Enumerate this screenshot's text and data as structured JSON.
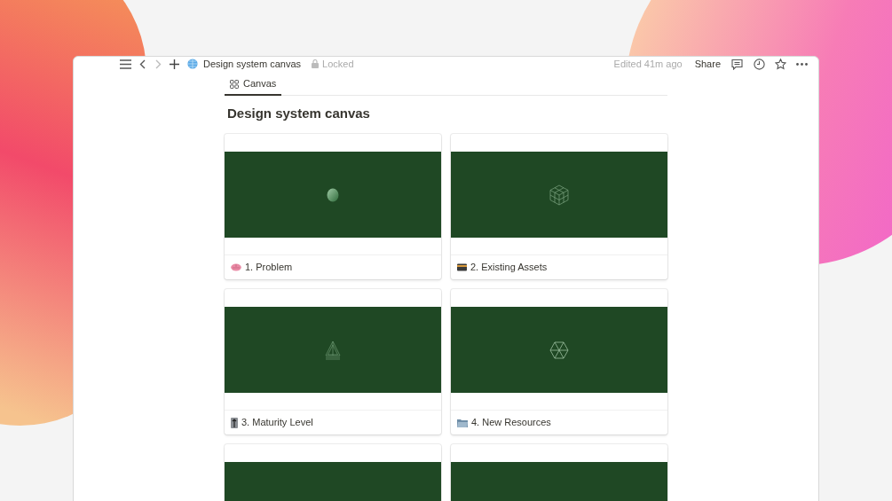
{
  "topbar": {
    "page_title": "Design system canvas",
    "lock_label": "Locked",
    "edited": "Edited 41m ago",
    "share": "Share"
  },
  "tabs": [
    {
      "label": "Canvas",
      "selected": true
    }
  ],
  "heading": "Design system canvas",
  "cards": [
    {
      "kind": "full",
      "title": "1. Problem"
    },
    {
      "kind": "full",
      "title": "2. Existing Assets"
    },
    {
      "kind": "full",
      "title": "3. Maturity Level"
    },
    {
      "kind": "full",
      "title": "4. New Resources"
    },
    {
      "kind": "partial"
    },
    {
      "kind": "partial"
    }
  ]
}
